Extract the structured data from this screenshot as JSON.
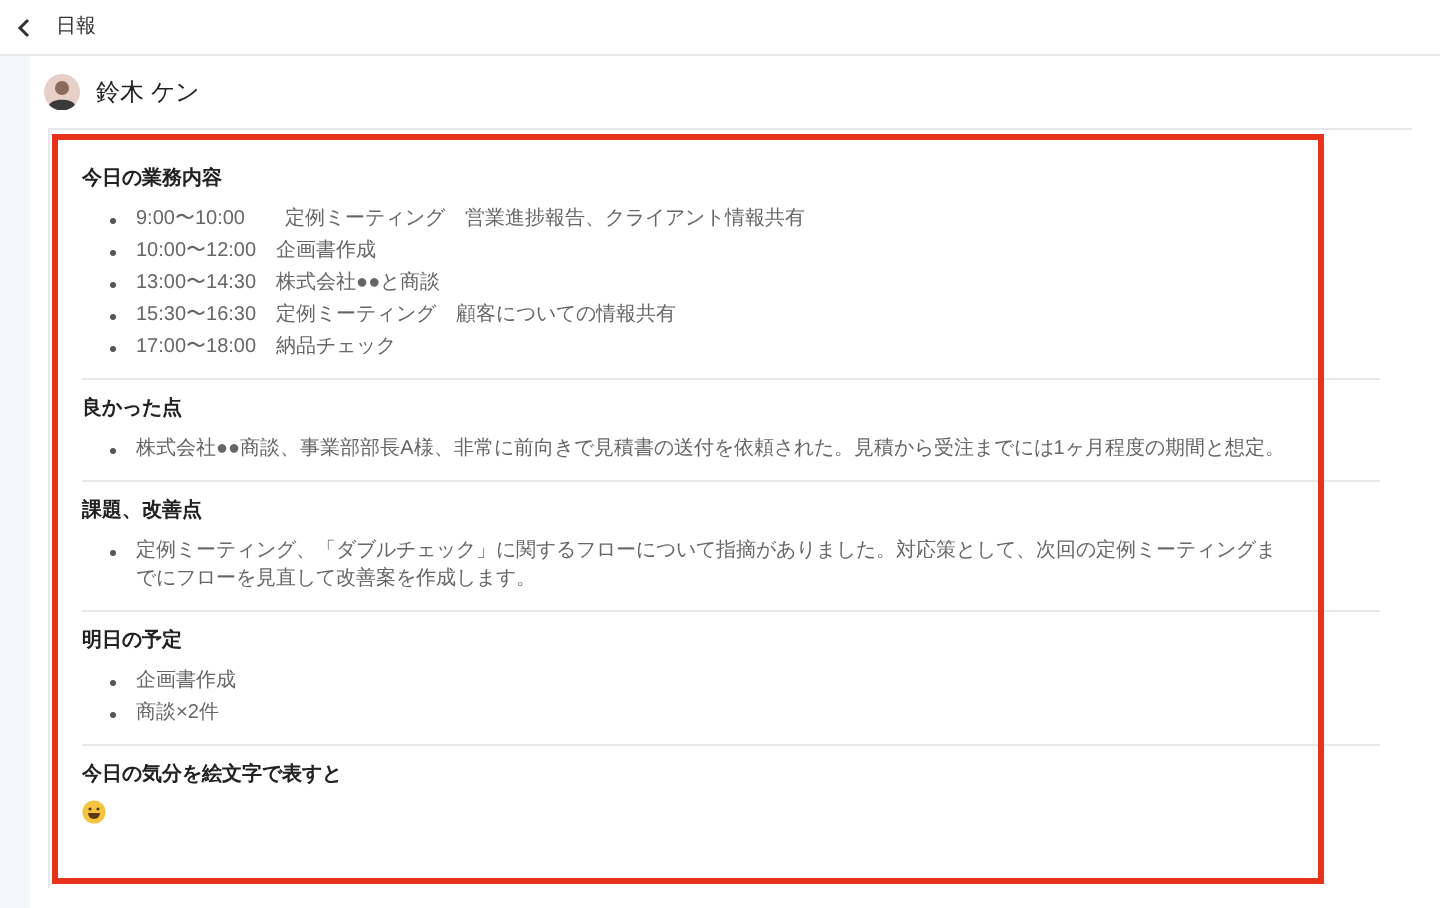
{
  "header": {
    "title": "日報"
  },
  "user": {
    "name": "鈴木 ケン"
  },
  "sections": [
    {
      "title": "今日の業務内容",
      "items": [
        "9:00〜10:00　　定例ミーティング　営業進捗報告、クライアント情報共有",
        "10:00〜12:00　企画書作成",
        "13:00〜14:30　株式会社●●と商談",
        "15:30〜16:30　定例ミーティング　顧客についての情報共有",
        "17:00〜18:00　納品チェック"
      ]
    },
    {
      "title": "良かった点",
      "items": [
        "株式会社●●商談、事業部部長A様、非常に前向きで見積書の送付を依頼された。見積から受注までには1ヶ月程度の期間と想定。"
      ]
    },
    {
      "title": "課題、改善点",
      "items": [
        "定例ミーティング、「ダブルチェック」に関するフローについて指摘がありました。対応策として、次回の定例ミーティングまでにフローを見直して改善案を作成します。"
      ]
    },
    {
      "title": "明日の予定",
      "items": [
        "企画書作成",
        "商談×2件"
      ]
    },
    {
      "title": "今日の気分を絵文字で表すと",
      "kind": "emoji"
    }
  ]
}
